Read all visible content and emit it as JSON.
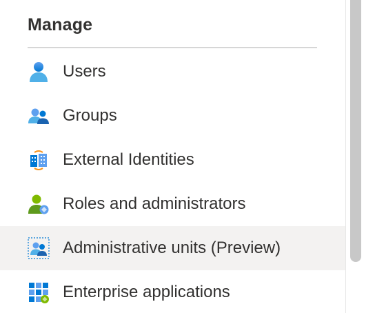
{
  "section": {
    "title": "Manage"
  },
  "nav": {
    "items": [
      {
        "label": "Users",
        "icon": "user-icon"
      },
      {
        "label": "Groups",
        "icon": "groups-icon"
      },
      {
        "label": "External Identities",
        "icon": "external-identities-icon"
      },
      {
        "label": "Roles and administrators",
        "icon": "roles-admin-icon"
      },
      {
        "label": "Administrative units (Preview)",
        "icon": "admin-units-icon",
        "selected": true
      },
      {
        "label": "Enterprise applications",
        "icon": "enterprise-apps-icon"
      }
    ]
  },
  "colors": {
    "selected_background": "#f3f2f1",
    "accent_blue": "#0078d4",
    "text": "#323130"
  }
}
